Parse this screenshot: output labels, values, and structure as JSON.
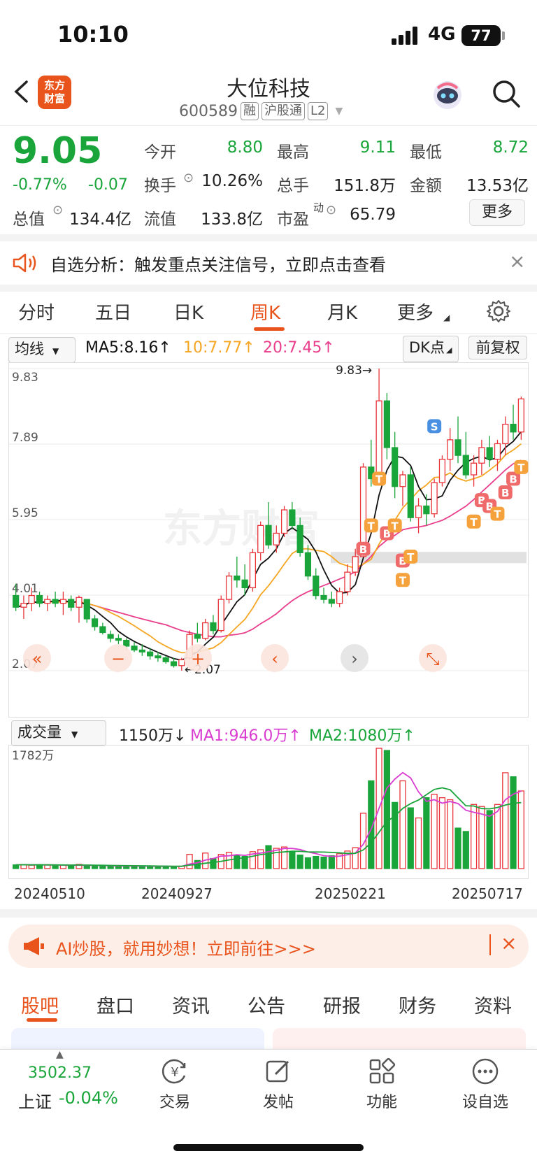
{
  "status": {
    "time": "10:10",
    "network": "4G",
    "battery": "77"
  },
  "header": {
    "back_label": "‹",
    "logo": "东方\n财富",
    "stock_name": "大位科技",
    "code": "600589",
    "tags": [
      "融",
      "沪股通",
      "L2"
    ]
  },
  "quote": {
    "price": "9.05",
    "change_pct": "-0.77%",
    "change": "-0.07",
    "open_label": "今开",
    "open": "8.80",
    "high_label": "最高",
    "high": "9.11",
    "low_label": "最低",
    "low": "8.72",
    "turnover_label": "换手",
    "turnover": "10.26%",
    "volume_label": "总手",
    "volume": "151.8万",
    "amount_label": "金额",
    "amount": "13.53亿",
    "mktcap_label": "总值",
    "mktcap": "134.4亿",
    "float_label": "流值",
    "float": "133.8亿",
    "pe_label": "市盈",
    "pe_sup": "动",
    "pe": "65.79",
    "more": "更多"
  },
  "notice": {
    "text": "自选分析：触发重点关注信号，立即点击查看",
    "close": "×"
  },
  "tabs": [
    "分时",
    "五日",
    "日K",
    "周K",
    "月K",
    "更多"
  ],
  "active_tab": "周K",
  "chart_controls": {
    "ma_select": "均线",
    "ma5": "MA5:8.16↑",
    "ma10": "10:7.77↑",
    "ma20": "20:7.45↑",
    "dk": "DK点",
    "adjust": "前复权"
  },
  "chart_labels": {
    "y_ticks": [
      "9.83",
      "7.89",
      "5.95",
      "4.01",
      "2.07"
    ],
    "max_marker": "9.83→",
    "min_marker": "←2.07",
    "watermark": "东方财富"
  },
  "volume_controls": {
    "select": "成交量",
    "current": "1150万↓",
    "ma1": "MA1:946.0万↑",
    "ma2": "MA2:1080万↑",
    "max_label": "1782万"
  },
  "dates": [
    "20240510",
    "20240927",
    "20250221",
    "20250717"
  ],
  "colors": {
    "up": "#e8343a",
    "down": "#1aa53b",
    "ma5": "#111111",
    "ma10": "#f5a623",
    "ma20": "#e83e8c",
    "accent": "#e8541c"
  },
  "chart_data": {
    "type": "candlestick",
    "period": "weekly",
    "ylim": [
      2.07,
      9.83
    ],
    "candles": [
      [
        4.0,
        4.3,
        3.6,
        3.7
      ],
      [
        3.7,
        4.0,
        3.4,
        3.8
      ],
      [
        3.8,
        4.2,
        3.6,
        4.0
      ],
      [
        4.0,
        4.1,
        3.7,
        3.8
      ],
      [
        3.8,
        4.0,
        3.6,
        3.9
      ],
      [
        3.9,
        4.1,
        3.7,
        3.8
      ],
      [
        3.8,
        4.1,
        3.5,
        3.9
      ],
      [
        3.9,
        4.0,
        3.6,
        3.7
      ],
      [
        3.7,
        4.0,
        3.3,
        3.95
      ],
      [
        3.9,
        3.9,
        3.3,
        3.4
      ],
      [
        3.4,
        3.5,
        3.1,
        3.2
      ],
      [
        3.2,
        3.3,
        3.0,
        3.05
      ],
      [
        3.0,
        3.1,
        2.8,
        2.9
      ],
      [
        2.9,
        3.0,
        2.75,
        2.85
      ],
      [
        2.85,
        2.9,
        2.6,
        2.7
      ],
      [
        2.7,
        2.8,
        2.55,
        2.6
      ],
      [
        2.6,
        2.75,
        2.45,
        2.55
      ],
      [
        2.55,
        2.65,
        2.35,
        2.45
      ],
      [
        2.45,
        2.55,
        2.3,
        2.4
      ],
      [
        2.4,
        2.45,
        2.25,
        2.3
      ],
      [
        2.3,
        2.4,
        2.15,
        2.2
      ],
      [
        2.2,
        2.4,
        2.07,
        2.35
      ],
      [
        2.4,
        3.1,
        2.35,
        3.0
      ],
      [
        3.0,
        3.3,
        2.8,
        2.9
      ],
      [
        2.9,
        3.4,
        2.85,
        3.3
      ],
      [
        3.3,
        3.5,
        3.0,
        3.1
      ],
      [
        3.1,
        4.0,
        3.05,
        3.9
      ],
      [
        3.9,
        4.6,
        3.8,
        4.5
      ],
      [
        4.5,
        5.0,
        4.2,
        4.4
      ],
      [
        4.4,
        4.8,
        4.0,
        4.2
      ],
      [
        4.2,
        5.2,
        4.1,
        5.1
      ],
      [
        5.1,
        5.9,
        4.9,
        5.8
      ],
      [
        5.8,
        6.4,
        5.2,
        5.3
      ],
      [
        5.3,
        5.8,
        5.1,
        5.6
      ],
      [
        5.6,
        6.3,
        5.5,
        6.2
      ],
      [
        6.2,
        6.4,
        5.7,
        5.8
      ],
      [
        5.8,
        6.0,
        5.0,
        5.1
      ],
      [
        5.1,
        5.3,
        4.4,
        4.5
      ],
      [
        4.5,
        4.7,
        3.9,
        4.0
      ],
      [
        4.0,
        4.2,
        3.8,
        3.9
      ],
      [
        3.9,
        4.1,
        3.7,
        3.8
      ],
      [
        3.8,
        4.2,
        3.7,
        4.1
      ],
      [
        4.1,
        4.8,
        4.0,
        4.6
      ],
      [
        4.6,
        5.2,
        4.5,
        5.0
      ],
      [
        5.0,
        7.4,
        5.0,
        7.3
      ],
      [
        7.3,
        8.0,
        6.8,
        7.0
      ],
      [
        7.0,
        9.83,
        6.9,
        9.0
      ],
      [
        9.0,
        9.2,
        7.5,
        7.8
      ],
      [
        7.8,
        8.2,
        6.5,
        6.8
      ],
      [
        6.8,
        7.2,
        6.3,
        7.1
      ],
      [
        7.1,
        7.3,
        5.9,
        6.0
      ],
      [
        6.0,
        6.5,
        5.6,
        6.3
      ],
      [
        6.3,
        6.6,
        5.8,
        6.1
      ],
      [
        6.1,
        7.0,
        6.0,
        6.9
      ],
      [
        6.9,
        7.6,
        6.8,
        7.5
      ],
      [
        7.5,
        8.3,
        7.2,
        8.0
      ],
      [
        8.0,
        8.6,
        7.4,
        7.6
      ],
      [
        7.6,
        8.2,
        7.0,
        7.1
      ],
      [
        7.1,
        7.6,
        6.8,
        7.4
      ],
      [
        7.4,
        8.0,
        7.1,
        7.8
      ],
      [
        7.8,
        8.1,
        7.3,
        7.5
      ],
      [
        7.5,
        8.0,
        7.2,
        7.9
      ],
      [
        7.9,
        8.6,
        7.6,
        8.4
      ],
      [
        8.4,
        8.9,
        8.0,
        8.2
      ],
      [
        8.2,
        9.11,
        8.0,
        9.05
      ]
    ],
    "volume": [
      55,
      60,
      50,
      58,
      52,
      48,
      50,
      45,
      62,
      40,
      42,
      38,
      36,
      40,
      35,
      38,
      36,
      34,
      30,
      32,
      30,
      36,
      210,
      120,
      230,
      150,
      210,
      240,
      200,
      180,
      250,
      280,
      340,
      300,
      320,
      250,
      200,
      160,
      180,
      170,
      190,
      220,
      260,
      310,
      820,
      1300,
      1782,
      1750,
      980,
      1300,
      900,
      750,
      1050,
      1100,
      1050,
      1020,
      600,
      550,
      950,
      920,
      860,
      950,
      1420,
      1360,
      1150
    ],
    "volume_ylim": [
      0,
      1782
    ]
  },
  "ad": {
    "text": "AI炒股，就用妙想！立即前往>>>",
    "close": "×"
  },
  "bottom_tabs": [
    "股吧",
    "盘口",
    "资讯",
    "公告",
    "研报",
    "财务",
    "资料"
  ],
  "active_bottom_tab": "股吧",
  "index": {
    "value": "3502.37",
    "name": "上证",
    "change": "-0.04%"
  },
  "toolbar": [
    "交易",
    "发帖",
    "功能",
    "设自选"
  ]
}
